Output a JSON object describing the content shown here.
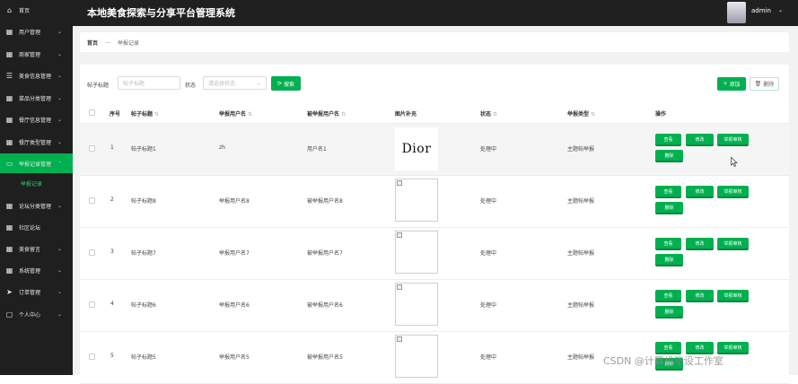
{
  "app": {
    "title": "本地美食探索与分享平台管理系统",
    "user": "admin",
    "accent_color": "#00b050"
  },
  "sidebar": {
    "items": [
      {
        "label": "首页",
        "icon": "home-icon",
        "has_chevron": false
      },
      {
        "label": "用户管理",
        "icon": "grid-icon",
        "has_chevron": true
      },
      {
        "label": "商家管理",
        "icon": "grid-icon",
        "has_chevron": true
      },
      {
        "label": "美食信息管理",
        "icon": "sliders-icon",
        "has_chevron": true
      },
      {
        "label": "菜品分类管理",
        "icon": "grid-icon",
        "has_chevron": true
      },
      {
        "label": "餐厅信息管理",
        "icon": "grid-icon",
        "has_chevron": true
      },
      {
        "label": "餐厅类型管理",
        "icon": "grid-icon",
        "has_chevron": true
      },
      {
        "label": "举报记录管理",
        "icon": "monitor-icon",
        "has_chevron": true,
        "active": true
      },
      {
        "label": "论坛分类管理",
        "icon": "grid-icon",
        "has_chevron": true
      },
      {
        "label": "社区论坛",
        "icon": "grid-icon",
        "has_chevron": false
      },
      {
        "label": "美食留言",
        "icon": "grid-icon",
        "has_chevron": true
      },
      {
        "label": "系统管理",
        "icon": "grid-icon",
        "has_chevron": true
      },
      {
        "label": "订单管理",
        "icon": "send-icon",
        "has_chevron": true
      },
      {
        "label": "个人中心",
        "icon": "user-icon",
        "has_chevron": true
      }
    ],
    "subitem": "举报记录"
  },
  "breadcrumb": {
    "home": "首页",
    "separator": "—",
    "current": "举报记录"
  },
  "filters": {
    "title_label": "帖子标题",
    "title_placeholder": "帖子标题",
    "status_label": "状态",
    "status_placeholder": "请选择状态",
    "search_button": "搜索",
    "add_button": "添加",
    "delete_button": "删除"
  },
  "table": {
    "headers": [
      "序号",
      "帖子标题",
      "举报用户名",
      "被举报用户名",
      "图片补充",
      "状态",
      "举报类型",
      "操作"
    ],
    "rows": [
      {
        "index": "1",
        "title": "帖子标题1",
        "reporter": "zh",
        "reported": "用户名1",
        "image": "Dior",
        "status": "处理中",
        "type": "主题帖举报"
      },
      {
        "index": "2",
        "title": "帖子标题8",
        "reporter": "举报用户名8",
        "reported": "被举报用户名8",
        "image": "",
        "status": "处理中",
        "type": "主题帖举报"
      },
      {
        "index": "3",
        "title": "帖子标题7",
        "reporter": "举报用户名7",
        "reported": "被举报用户名7",
        "image": "",
        "status": "处理中",
        "type": "主题帖举报"
      },
      {
        "index": "4",
        "title": "帖子标题6",
        "reporter": "举报用户名6",
        "reported": "被举报用户名6",
        "image": "",
        "status": "处理中",
        "type": "主题帖举报"
      },
      {
        "index": "5",
        "title": "帖子标题5",
        "reporter": "举报用户名5",
        "reported": "被举报用户名5",
        "image": "",
        "status": "处理中",
        "type": "主题帖举报"
      }
    ],
    "actions": {
      "view": "查看",
      "edit": "修改",
      "review": "举报审核",
      "delete": "删除"
    }
  },
  "watermark": "CSDN @计算机毕设工作室"
}
